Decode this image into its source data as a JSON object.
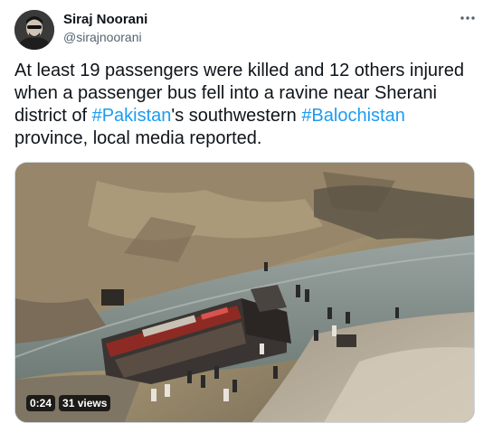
{
  "author": {
    "name": "Siraj Noorani",
    "handle": "@sirajnoorani"
  },
  "tweet": {
    "line1": "At least 19 passengers were killed and 12 others injured",
    "line2": "when a passenger bus fell into a ravine near Sherani",
    "line3_pre": "district of ",
    "hashtag1": "#Pakistan",
    "line3_mid": "'s southwestern ",
    "hashtag2": "#Balochistan",
    "line4": "province, local media reported."
  },
  "video": {
    "duration": "0:24",
    "views": "31 views"
  },
  "icons": {
    "more": "more-icon"
  },
  "colors": {
    "link": "#1d9bf0",
    "text": "#0f1419",
    "secondary": "#536471"
  }
}
